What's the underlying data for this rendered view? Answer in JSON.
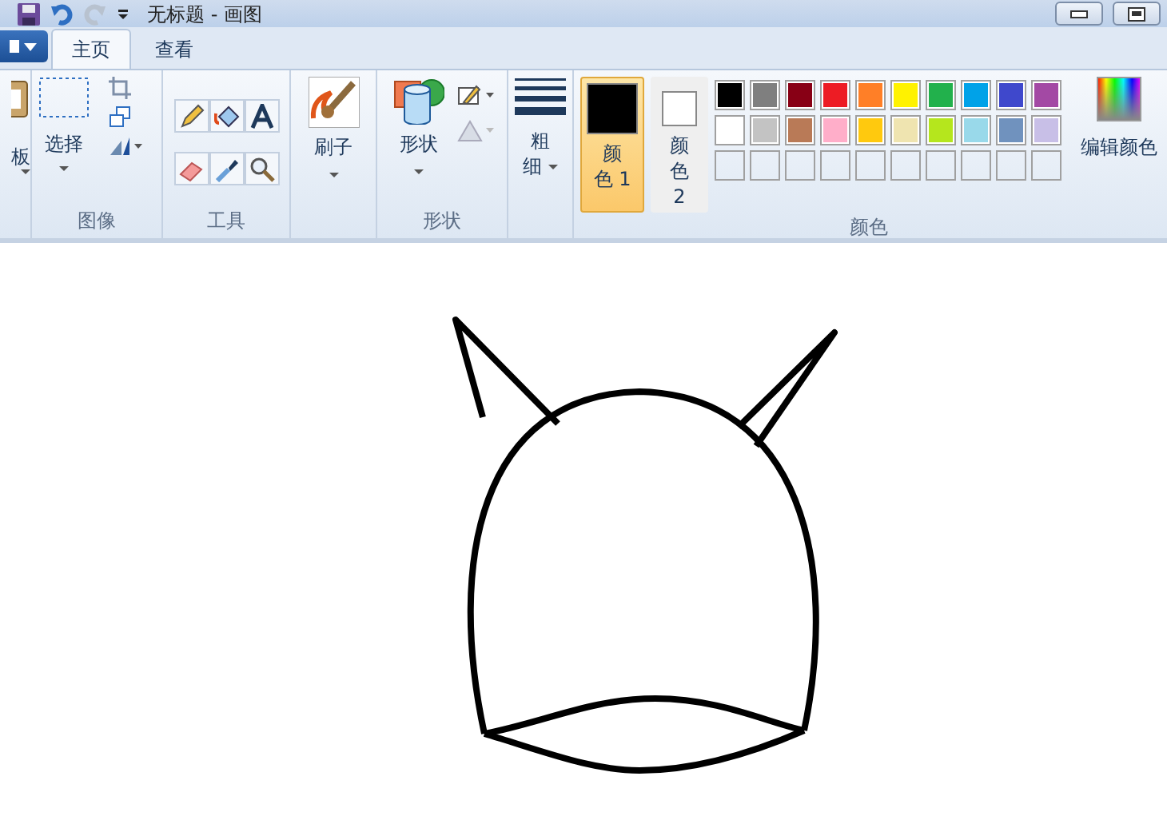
{
  "window": {
    "title": "无标题 - 画图"
  },
  "tabs": [
    {
      "label": "主页",
      "selected": true
    },
    {
      "label": "查看",
      "selected": false
    }
  ],
  "ribbon": {
    "clipboard": {
      "label": "板"
    },
    "image": {
      "select_label": "选择",
      "group_label": "图像"
    },
    "tools": {
      "group_label": "工具"
    },
    "brushes": {
      "label": "刷子"
    },
    "shapes": {
      "label": "形状",
      "group_label": "形状"
    },
    "size": {
      "label_top": "粗",
      "label_bottom": "细"
    },
    "colors": {
      "group_label": "颜色",
      "current": [
        {
          "label_top": "颜",
          "label_bottom": "色 1",
          "color": "#000000",
          "selected": true
        },
        {
          "label_top": "颜",
          "label_bottom": "色 2",
          "color": "#ffffff",
          "selected": false
        }
      ],
      "palette": [
        {
          "color": "#000000"
        },
        {
          "color": "#7f7f7f"
        },
        {
          "color": "#880015"
        },
        {
          "color": "#ed1c24"
        },
        {
          "color": "#ff7f27"
        },
        {
          "color": "#fff200"
        },
        {
          "color": "#22b14c"
        },
        {
          "color": "#00a2e8"
        },
        {
          "color": "#3f48cc"
        },
        {
          "color": "#a349a4"
        },
        {
          "color": "#ffffff"
        },
        {
          "color": "#c3c3c3"
        },
        {
          "color": "#b97a57"
        },
        {
          "color": "#ffaec9"
        },
        {
          "color": "#ffc90e"
        },
        {
          "color": "#efe4b0"
        },
        {
          "color": "#b5e61d"
        },
        {
          "color": "#99d9ea"
        },
        {
          "color": "#7092be"
        },
        {
          "color": "#c8bfe7"
        }
      ],
      "edit_label": "编辑颜色"
    }
  }
}
